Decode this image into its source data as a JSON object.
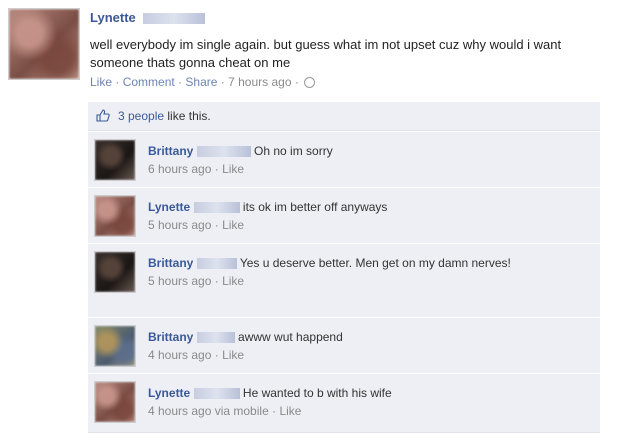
{
  "post": {
    "author": "Lynette",
    "text": "well everybody im single again. but guess what im not upset cuz why would i want someone thats gonna cheat on me",
    "actions": {
      "like": "Like",
      "comment": "Comment",
      "share": "Share",
      "time": "7 hours ago"
    },
    "separator": "·"
  },
  "likes": {
    "people": "3 people",
    "suffix": "like this."
  },
  "comments": [
    {
      "author": "Brittany",
      "text": "Oh no im sorry",
      "time": "6 hours ago",
      "like": "Like"
    },
    {
      "author": "Lynette",
      "text": "its ok im better off anyways",
      "time": "5 hours ago",
      "like": "Like"
    },
    {
      "author": "Brittany",
      "text": "Yes u deserve better. Men get on my damn nerves!",
      "time": "5 hours ago",
      "like": "Like"
    },
    {
      "author": "Brittany",
      "text": "awww wut happend",
      "time": "4 hours ago",
      "like": "Like"
    },
    {
      "author": "Lynette",
      "text": "He wanted to b with his wife",
      "time": "4 hours ago via mobile",
      "like": "Like"
    }
  ],
  "colors": {
    "link": "#3b5998",
    "meta": "#8a8a8a",
    "comment_bg": "#edeff4"
  },
  "icons": {
    "like": "thumbs-up-icon",
    "privacy": "globe-icon"
  }
}
